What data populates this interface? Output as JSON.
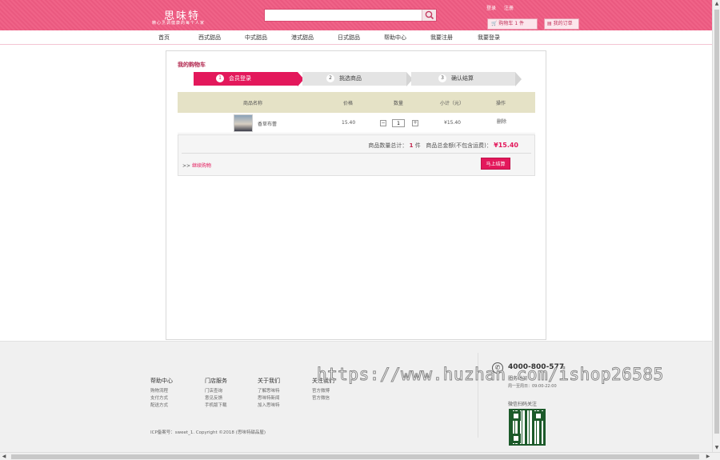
{
  "header": {
    "logo": "思味特",
    "slogan": "精心烹调健康的每个人家",
    "search_placeholder": "",
    "user_links": [
      "登录",
      "注册"
    ],
    "cart_label": "购物车 1 件",
    "orders_label": "我的订单"
  },
  "nav": {
    "items": [
      "首页",
      "西式甜品",
      "中式甜品",
      "港式甜品",
      "日式甜品",
      "帮助中心",
      "我要注册",
      "我要登录"
    ]
  },
  "cart": {
    "title": "我的购物车",
    "steps": [
      {
        "num": "1",
        "label": "会员登录"
      },
      {
        "num": "2",
        "label": "挑选商品"
      },
      {
        "num": "3",
        "label": "确认结算"
      }
    ],
    "columns": [
      "商品名称",
      "价格",
      "数量",
      "小计（元）",
      "操作"
    ],
    "rows": [
      {
        "name": "香草布蕾",
        "price": "15.40",
        "qty": "1",
        "subtotal": "¥15.40",
        "action": "删除"
      }
    ],
    "summary_count_label": "商品数量总计：",
    "summary_count": "1",
    "summary_count_unit": "件",
    "summary_total_label": "商品总金额(不包含运费)：",
    "summary_total": "¥15.40",
    "continue_prefix": ">>",
    "continue_link": "继续购物",
    "checkout_label": "马上结算"
  },
  "footer": {
    "columns": [
      {
        "title": "帮助中心",
        "items": [
          "购物流程",
          "支付方式",
          "配送方式"
        ]
      },
      {
        "title": "门店服务",
        "items": [
          "门店查询",
          "意见反馈",
          "手机版下载"
        ]
      },
      {
        "title": "关于我们",
        "items": [
          "了解思味特",
          "思味特新闻",
          "加入思味特"
        ]
      },
      {
        "title": "关注我们",
        "items": [
          "官方微博",
          "官方微信"
        ]
      }
    ],
    "copyright": "ICP备案号：sweet_1. Copyright ©2018 (思味特甜品屋)",
    "phone": "4000-800-577",
    "hours_title": "服务时间",
    "hours": "周一至周日：09:00-22:00",
    "wechat_title": "微信扫码关注"
  },
  "watermark": "https://www.huzhan.com/ishop26585",
  "colors": {
    "brand": "#ef5b82",
    "accent": "#e3185b",
    "table_header": "#e5e2c6"
  }
}
